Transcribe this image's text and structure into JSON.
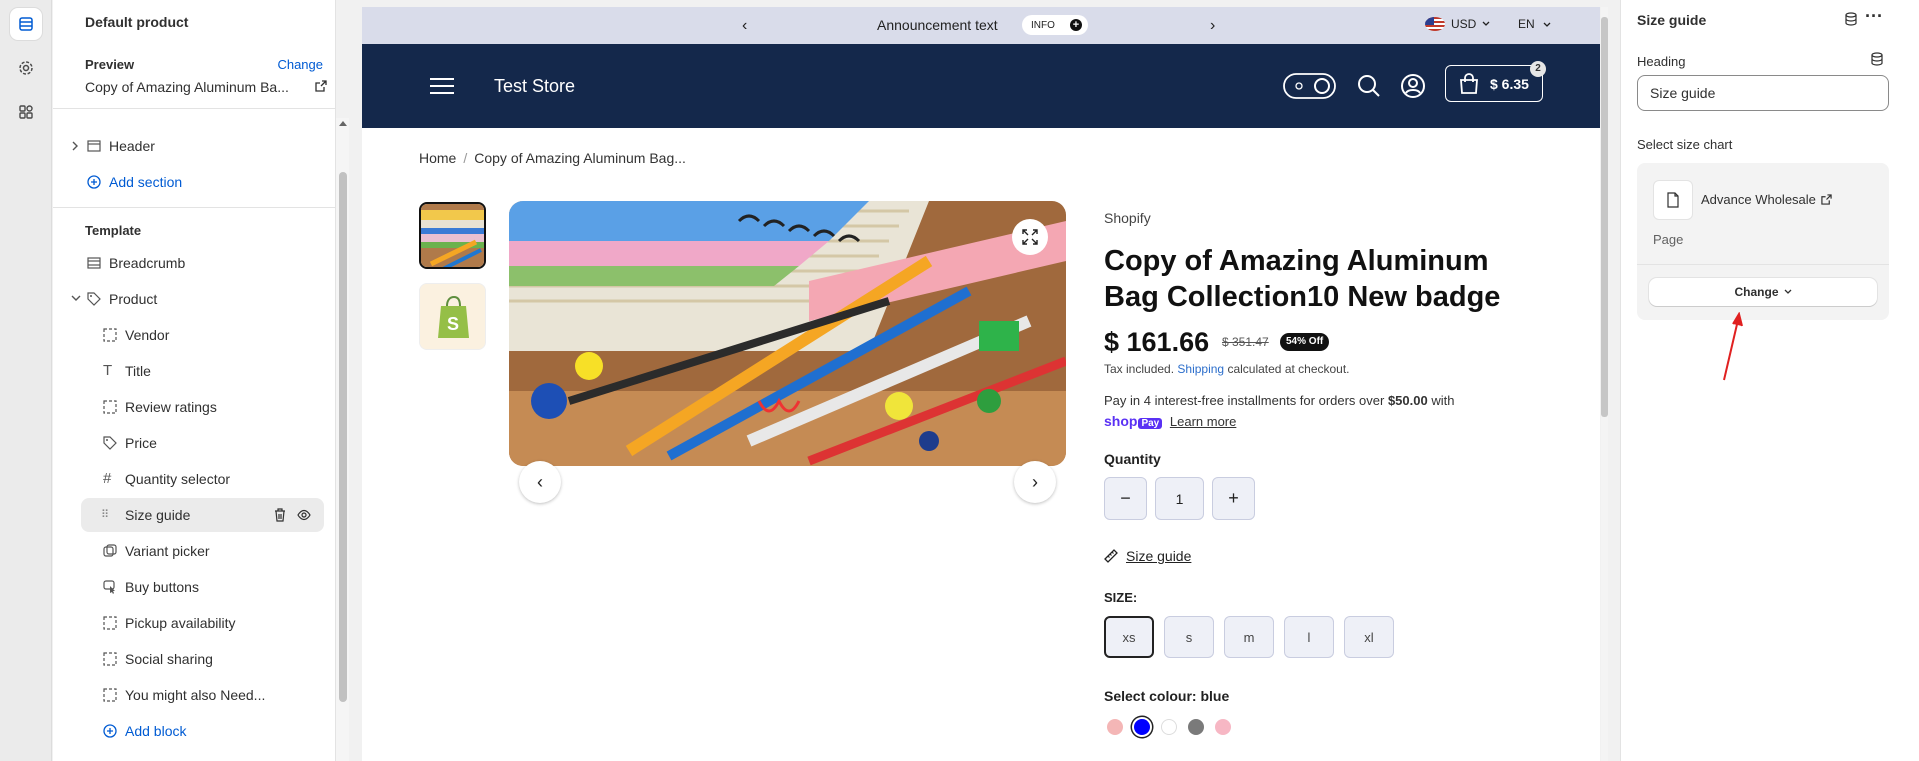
{
  "left_panel": {
    "page_title": "Default product",
    "preview_label": "Preview",
    "change_label": "Change",
    "preview_value": "Copy of Amazing Aluminum Ba...",
    "header_item": "Header",
    "add_section": "Add section",
    "template_label": "Template",
    "breadcrumb_item": "Breadcrumb",
    "product_item": "Product",
    "blocks": [
      "Vendor",
      "Title",
      "Review ratings",
      "Price",
      "Quantity selector",
      "Size guide",
      "Variant picker",
      "Buy buttons",
      "Pickup availability",
      "Social sharing",
      "You might also Need..."
    ],
    "add_block": "Add block"
  },
  "announcement": {
    "text": "Announcement text",
    "badge": "INFO",
    "currency": "USD",
    "language": "EN"
  },
  "store": {
    "name": "Test Store",
    "cart_total": "$ 6.35",
    "cart_count": "2"
  },
  "breadcrumb": {
    "home": "Home",
    "separator": "/",
    "current": "Copy of Amazing Aluminum Bag..."
  },
  "product": {
    "vendor": "Shopify",
    "title": "Copy of Amazing Aluminum Bag Collection10 New badge",
    "price": "$ 161.66",
    "compare_price": "$ 351.47",
    "discount_badge": "54% Off",
    "tax_text_before": "Tax included. ",
    "tax_link": "Shipping",
    "tax_text_after": " calculated at checkout.",
    "installments_text": "Pay in 4 interest-free installments for orders over ",
    "installments_amount": "$50.00",
    "installments_with": " with",
    "shop_label": "shop",
    "pay_label": "Pay",
    "learn_more": "Learn more",
    "quantity_label": "Quantity",
    "quantity_value": "1",
    "size_guide_link": "Size guide",
    "size_label": "SIZE:",
    "sizes": [
      "xs",
      "s",
      "m",
      "l",
      "xl"
    ],
    "selected_size": "xs",
    "colour_label": "Select colour: blue",
    "swatches": [
      "#f4b6b6",
      "#0000ff",
      "#ffffff",
      "#7a7a7a",
      "#f7b7c4"
    ],
    "selected_swatch_index": 1
  },
  "right_panel": {
    "title": "Size guide",
    "heading_label": "Heading",
    "heading_value": "Size guide",
    "select_chart_label": "Select size chart",
    "page_name": "Advance Wholesale",
    "page_type": "Page",
    "change_button": "Change"
  },
  "colors": {
    "accent_link": "#005bd3",
    "header_bg": "#14284b",
    "announcement_bg": "#d9dcea",
    "annotation_arrow": "#e02020"
  }
}
